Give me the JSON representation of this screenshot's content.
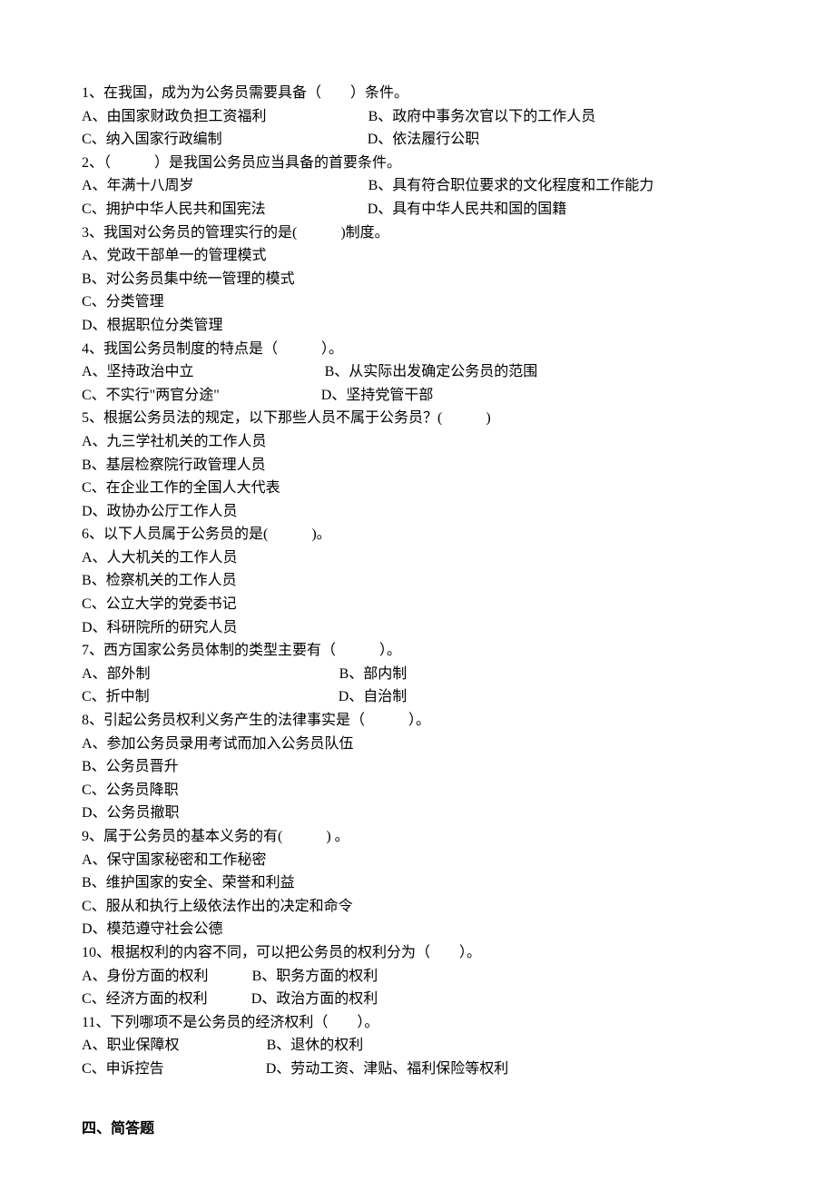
{
  "q1": {
    "stem": "1、在我国，成为为公务员需要具备（　　）条件。",
    "a": "A、由国家财政负担工资福利",
    "b": "B、政府中事务次官以下的工作人员",
    "c": "C、纳入国家行政编制",
    "d": "D、依法履行公职"
  },
  "q2": {
    "stem": "2、（　　　）是我国公务员应当具备的首要条件。",
    "a": "A、年满十八周岁",
    "b": "B、具有符合职位要求的文化程度和工作能力",
    "c": "C、拥护中华人民共和国宪法",
    "d": "D、具有中华人民共和国的国籍"
  },
  "q3": {
    "stem": "3、我国对公务员的管理实行的是(　　　)制度。",
    "a": "A、党政干部单一的管理模式",
    "b": "B、对公务员集中统一管理的模式",
    "c": "C、分类管理",
    "d": "D、根据职位分类管理"
  },
  "q4": {
    "stem": "4、我国公务员制度的特点是（　　　）。",
    "a": "A、坚持政治中立",
    "b": "B、从实际出发确定公务员的范围",
    "c": "C、不实行\"两官分途\"",
    "d": "D、坚持党管干部"
  },
  "q5": {
    "stem": "5、根据公务员法的规定，以下那些人员不属于公务员？(　　　)",
    "a": "A、九三学社机关的工作人员",
    "b": "B、基层检察院行政管理人员",
    "c": "C、在企业工作的全国人大代表",
    "d": "D、政协办公厅工作人员"
  },
  "q6": {
    "stem": "6、以下人员属于公务员的是(　　　)。",
    "a": "A、人大机关的工作人员",
    "b": "B、检察机关的工作人员",
    "c": "C、公立大学的党委书记",
    "d": "D、科研院所的研究人员"
  },
  "q7": {
    "stem": "7、西方国家公务员体制的类型主要有（　　　）。",
    "a": "A、部外制",
    "b": "B、部内制",
    "c": "C、折中制",
    "d": "D、自治制"
  },
  "q8": {
    "stem": "8、引起公务员权利义务产生的法律事实是（　　　）。",
    "a": "A、参加公务员录用考试而加入公务员队伍",
    "b": "B、公务员晋升",
    "c": "C、公务员降职",
    "d": "D、公务员撤职"
  },
  "q9": {
    "stem": "9、属于公务员的基本义务的有(　　　) 。",
    "a": "A、保守国家秘密和工作秘密",
    "b": "B、维护国家的安全、荣誉和利益",
    "c": "C、服从和执行上级依法作出的决定和命令",
    "d": "D、模范遵守社会公德"
  },
  "q10": {
    "stem": "10、根据权利的内容不同，可以把公务员的权利分为（　　）。",
    "a": "A、身份方面的权利",
    "b": "B、职务方面的权利",
    "c": "C、经济方面的权利",
    "d": "D、政治方面的权利"
  },
  "q11": {
    "stem": "11、下列哪项不是公务员的经济权利（　　）。",
    "a": "A、职业保障权",
    "b": "B、退休的权利",
    "c": "C、申诉控告",
    "d": "D、劳动工资、津贴、福利保险等权利"
  },
  "section4": "四、简答题"
}
